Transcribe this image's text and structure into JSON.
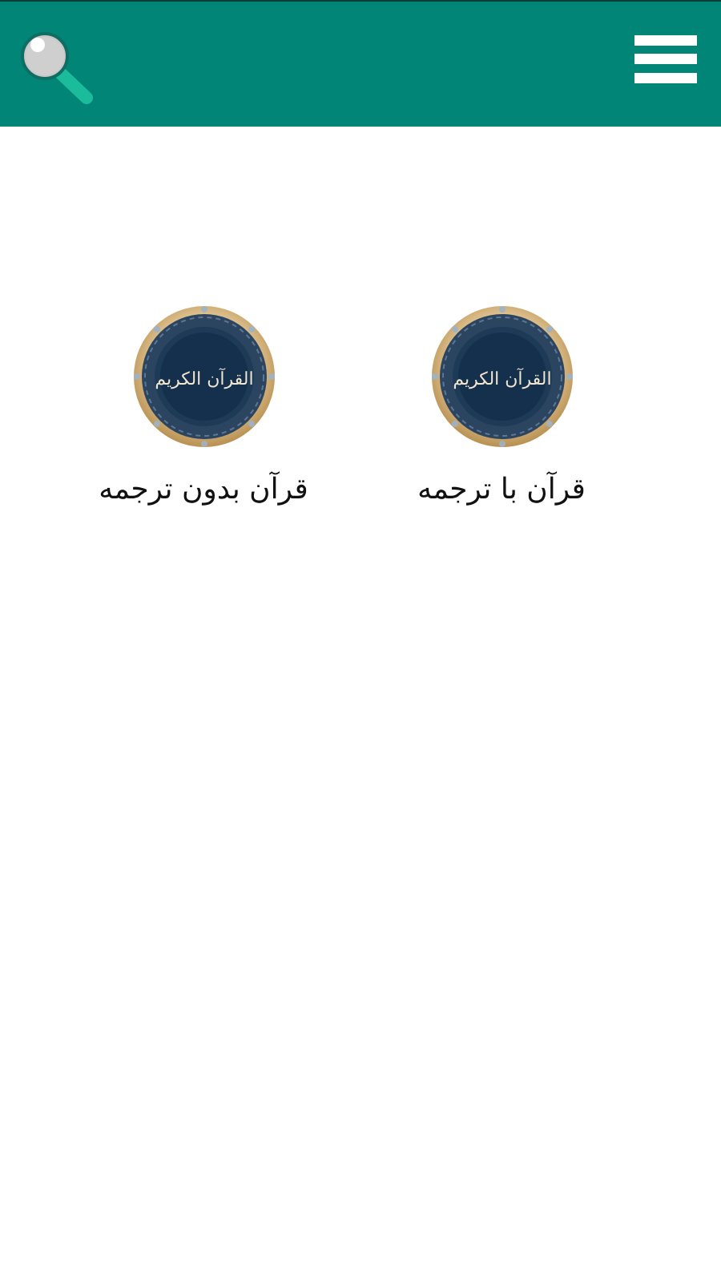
{
  "appbar": {
    "background": "#008577",
    "search_icon": "search-icon",
    "menu_icon": "hamburger-menu-icon"
  },
  "tiles": [
    {
      "label": "قرآن بدون ترجمه",
      "image_text": "القرآن الكريم",
      "icon": "quran-medallion-icon"
    },
    {
      "label": "قرآن با ترجمه",
      "image_text": "القرآن الكريم",
      "icon": "quran-medallion-icon"
    }
  ],
  "colors": {
    "medallion_navy": "#14304d",
    "medallion_gold": "#c9a56a",
    "text": "#111111"
  }
}
